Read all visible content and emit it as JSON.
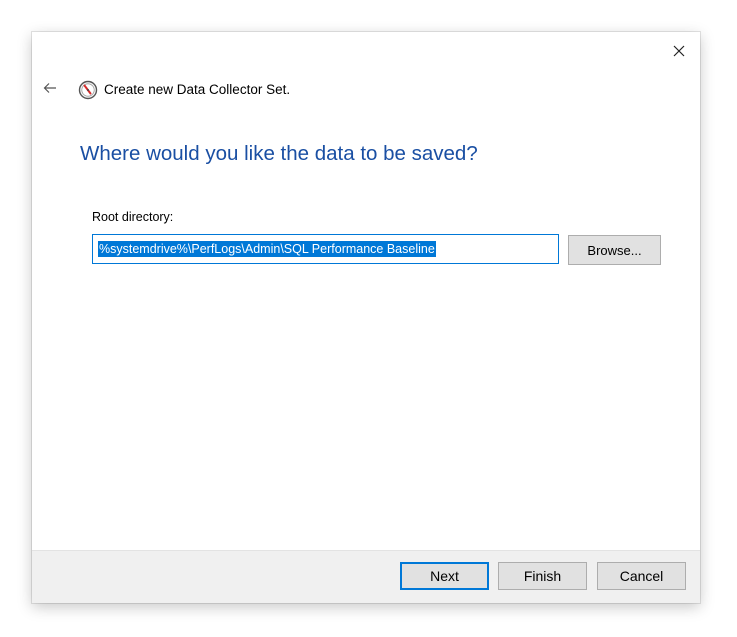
{
  "colors": {
    "accent": "#1a4fa3",
    "accent_light": "#0078d7",
    "selection": "#0078d7"
  },
  "window": {
    "close_icon": "close-icon"
  },
  "wizard": {
    "back_icon": "back-arrow-icon",
    "app_icon": "performance-monitor-icon",
    "title": "Create new Data Collector Set."
  },
  "page": {
    "heading": "Where would you like the data to be saved?",
    "root_directory_label": "Root directory:",
    "root_directory_value": "%systemdrive%\\PerfLogs\\Admin\\SQL Performance Baseline",
    "browse_label": "Browse..."
  },
  "footer": {
    "next_label": "Next",
    "finish_label": "Finish",
    "cancel_label": "Cancel"
  }
}
